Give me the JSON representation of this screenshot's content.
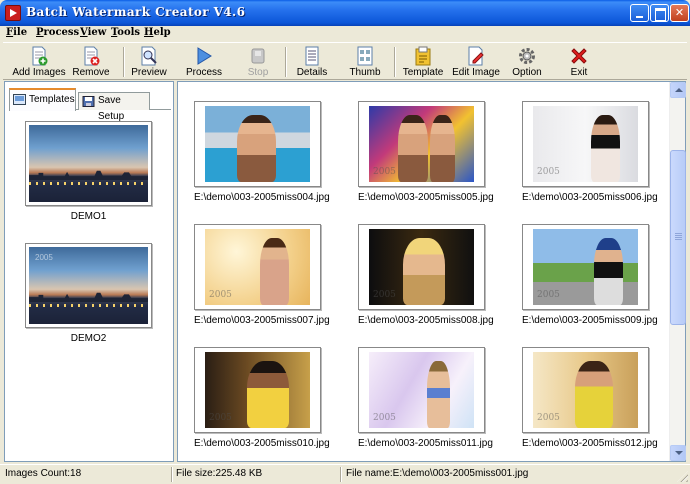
{
  "window": {
    "title": "Batch Watermark Creator V4.6"
  },
  "menu": {
    "items": [
      "File",
      "Process",
      "View",
      "Tools",
      "Help"
    ]
  },
  "toolbar": {
    "buttons": [
      {
        "label": "Add Images",
        "icon": "add-images-icon",
        "enabled": true
      },
      {
        "label": "Remove",
        "icon": "remove-icon",
        "enabled": true
      },
      {
        "label": "Preview",
        "icon": "preview-icon",
        "enabled": true
      },
      {
        "label": "Process",
        "icon": "play-icon",
        "enabled": true
      },
      {
        "label": "Stop",
        "icon": "stop-icon",
        "enabled": false
      },
      {
        "label": "Details",
        "icon": "details-icon",
        "enabled": true
      },
      {
        "label": "Thumb",
        "icon": "thumb-icon",
        "enabled": true
      },
      {
        "label": "Template",
        "icon": "template-icon",
        "enabled": true
      },
      {
        "label": "Edit Image",
        "icon": "edit-image-icon",
        "enabled": true
      },
      {
        "label": "Option",
        "icon": "gear-icon",
        "enabled": true
      },
      {
        "label": "Exit",
        "icon": "exit-x-icon",
        "enabled": true
      }
    ]
  },
  "left_panel": {
    "tabs": [
      {
        "label": "Templates",
        "active": true
      },
      {
        "label": "Save Setup",
        "active": false
      }
    ],
    "templates": [
      {
        "name": "DEMO1"
      },
      {
        "name": "DEMO2",
        "overlay": "2005"
      }
    ]
  },
  "images": [
    {
      "file": "E:\\demo\\003-2005miss004.jpg"
    },
    {
      "file": "E:\\demo\\003-2005miss005.jpg",
      "mark": "2005"
    },
    {
      "file": "E:\\demo\\003-2005miss006.jpg",
      "mark": "2005"
    },
    {
      "file": "E:\\demo\\003-2005miss007.jpg",
      "mark": "2005"
    },
    {
      "file": "E:\\demo\\003-2005miss008.jpg",
      "mark": "2005"
    },
    {
      "file": "E:\\demo\\003-2005miss009.jpg",
      "mark": "2005"
    },
    {
      "file": "E:\\demo\\003-2005miss010.jpg",
      "mark": "2005"
    },
    {
      "file": "E:\\demo\\003-2005miss011.jpg",
      "mark": "2005"
    },
    {
      "file": "E:\\demo\\003-2005miss012.jpg",
      "mark": "2005"
    }
  ],
  "status": {
    "images_count": "Images Count:18",
    "file_size": "File size:225.48 KB",
    "file_name": "File name:E:\\demo\\003-2005miss001.jpg"
  },
  "colors": {
    "titlebar": "#0c56d8",
    "window_bg": "#ece9d8",
    "panel_border": "#7f9db9",
    "active_tab_accent": "#e68b2c"
  }
}
